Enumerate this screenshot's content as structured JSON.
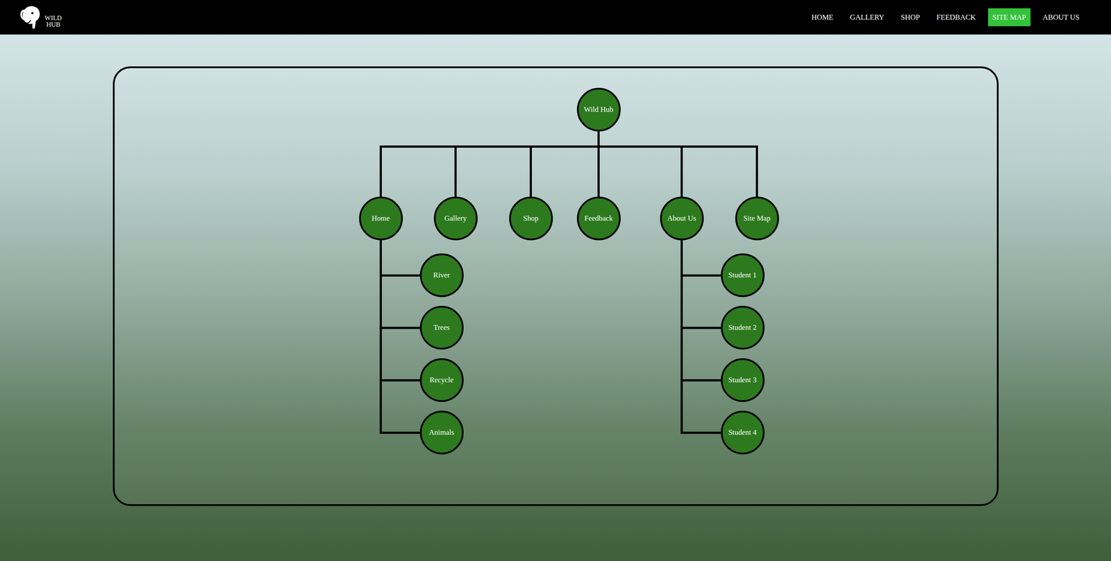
{
  "nav": {
    "logo": [
      "WILD",
      "HUB"
    ],
    "items": [
      {
        "label": "HOME",
        "selected": false
      },
      {
        "label": "GALLERY",
        "selected": false
      },
      {
        "label": "SHOP",
        "selected": false
      },
      {
        "label": "FEEDBACK",
        "selected": false
      },
      {
        "label": "SITE MAP",
        "selected": true
      },
      {
        "label": "ABOUT US",
        "selected": false
      }
    ]
  },
  "sitemap": {
    "label": "Wild Hub",
    "children": [
      {
        "label": "Home",
        "children": [
          {
            "label": "River"
          },
          {
            "label": "Trees"
          },
          {
            "label": "Recycle"
          },
          {
            "label": "Animals"
          }
        ]
      },
      {
        "label": "Gallery",
        "children": []
      },
      {
        "label": "Shop",
        "children": []
      },
      {
        "label": "Feedback",
        "children": []
      },
      {
        "label": "About Us",
        "children": [
          {
            "label": "Student 1"
          },
          {
            "label": "Student 2"
          },
          {
            "label": "Student 3"
          },
          {
            "label": "Student 4"
          }
        ]
      },
      {
        "label": "Site Map",
        "children": []
      }
    ]
  }
}
